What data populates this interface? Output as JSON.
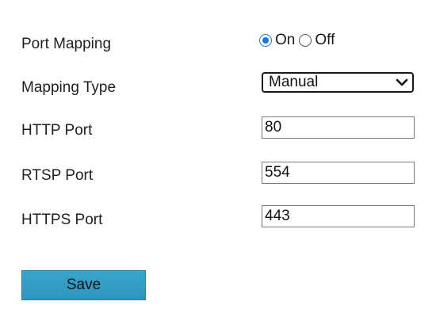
{
  "port_mapping": {
    "label": "Port Mapping",
    "options": [
      {
        "label": "On",
        "checked": true
      },
      {
        "label": "Off",
        "checked": false
      }
    ]
  },
  "mapping_type": {
    "label": "Mapping Type",
    "value": "Manual"
  },
  "http_port": {
    "label": "HTTP Port",
    "value": "80"
  },
  "rtsp_port": {
    "label": "RTSP Port",
    "value": "554"
  },
  "https_port": {
    "label": "HTTPS Port",
    "value": "443"
  },
  "save_button": {
    "label": "Save"
  },
  "colors": {
    "radio_accent": "#1a73e8",
    "button_fill": "#2f9ac3",
    "button_border": "#2a82a5"
  }
}
